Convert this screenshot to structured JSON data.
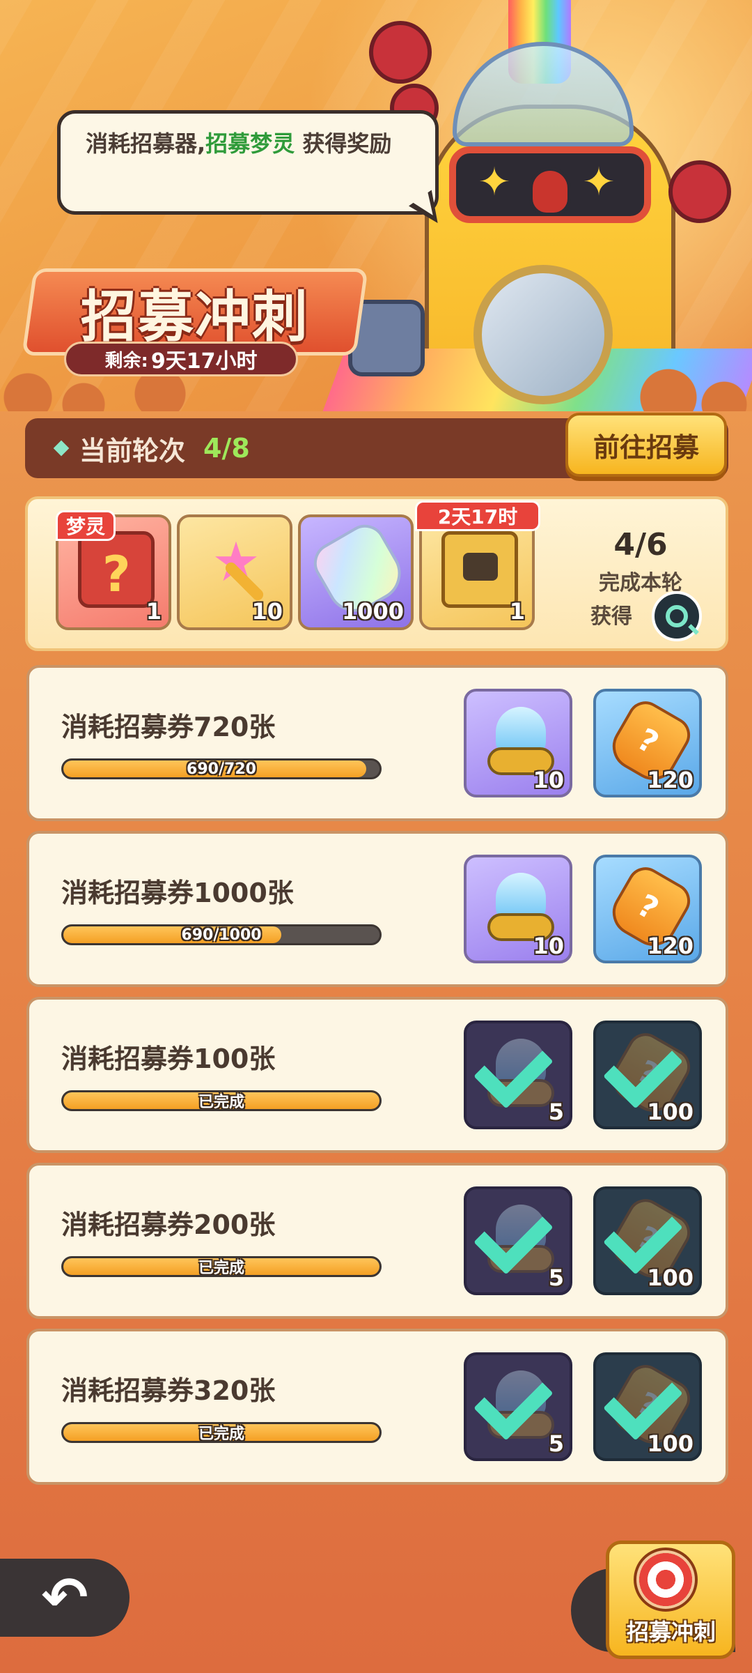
{
  "bubble": {
    "text_prefix": "消耗招募器,",
    "text_highlight": "招募梦灵",
    "text_suffix": " 获得奖励"
  },
  "event": {
    "title": "招募冲刺",
    "timer_label": "剩余:",
    "timer_value": "9天17小时"
  },
  "round": {
    "label": "当前轮次",
    "value": "4/8",
    "go_button": "前往招募"
  },
  "round_rewards": {
    "items": [
      {
        "icon": "mystery-chest-icon",
        "tag": "梦灵",
        "count": "1"
      },
      {
        "icon": "star-key-icon",
        "count": "10"
      },
      {
        "icon": "rainbow-bottle-icon",
        "count": "1000"
      },
      {
        "icon": "gift-bag-icon",
        "tag": "2天17时",
        "count": "1"
      }
    ],
    "progress": "4/6",
    "line1": "完成本轮",
    "line2": "获得"
  },
  "tasks": [
    {
      "title": "消耗招募券720张",
      "progress_text": "690/720",
      "progress": 0.958,
      "done": false,
      "rewards": [
        {
          "icon": "blue-flame-icon",
          "count": "10"
        },
        {
          "icon": "mystery-soda-icon",
          "count": "120"
        }
      ]
    },
    {
      "title": "消耗招募券1000张",
      "progress_text": "690/1000",
      "progress": 0.69,
      "done": false,
      "rewards": [
        {
          "icon": "blue-flame-icon",
          "count": "10"
        },
        {
          "icon": "mystery-soda-icon",
          "count": "120"
        }
      ]
    },
    {
      "title": "消耗招募券100张",
      "progress_text": "已完成",
      "progress": 1,
      "done": true,
      "rewards": [
        {
          "icon": "blue-flame-icon",
          "count": "5"
        },
        {
          "icon": "mystery-soda-icon",
          "count": "100"
        }
      ]
    },
    {
      "title": "消耗招募券200张",
      "progress_text": "已完成",
      "progress": 1,
      "done": true,
      "rewards": [
        {
          "icon": "blue-flame-icon",
          "count": "5"
        },
        {
          "icon": "mystery-soda-icon",
          "count": "100"
        }
      ]
    },
    {
      "title": "消耗招募券320张",
      "progress_text": "已完成",
      "progress": 1,
      "done": true,
      "rewards": [
        {
          "icon": "blue-flame-icon",
          "count": "5"
        },
        {
          "icon": "mystery-soda-icon",
          "count": "100"
        }
      ]
    }
  ],
  "bottom": {
    "sprint_label": "招募冲刺",
    "back_icon": "back-arrow-icon"
  },
  "colors": {
    "accent_green": "#2f9b3a",
    "progress_fill": "#f4a024",
    "check": "#4ee0bd"
  }
}
